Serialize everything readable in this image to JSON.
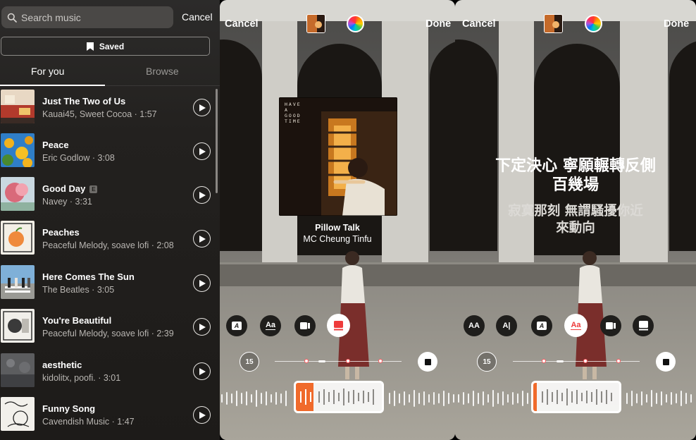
{
  "left_panel": {
    "search": {
      "placeholder": "Search music"
    },
    "cancel_label": "Cancel",
    "saved_label": "Saved",
    "tabs": [
      {
        "label": "For you",
        "active": true
      },
      {
        "label": "Browse",
        "active": false
      }
    ],
    "songs": [
      {
        "title": "Just The Two of Us",
        "meta": "Kauai45, Sweet Cocoa · 1:57",
        "explicit": false
      },
      {
        "title": "Peace",
        "meta": "Eric Godlow · 3:08",
        "explicit": false
      },
      {
        "title": "Good Day",
        "meta": "Navey · 3:31",
        "explicit": true,
        "badge": "E"
      },
      {
        "title": "Peaches",
        "meta": "Peaceful Melody, soave lofi · 2:08",
        "explicit": false
      },
      {
        "title": "Here Comes The Sun",
        "meta": "The Beatles · 3:05",
        "explicit": false
      },
      {
        "title": "You're Beautiful",
        "meta": "Peaceful Melody, soave lofi · 2:39",
        "explicit": false
      },
      {
        "title": "aesthetic",
        "meta": "kidolitx, poofi. · 3:01",
        "explicit": false
      },
      {
        "title": "Funny Song",
        "meta": "Cavendish Music · 1:47",
        "explicit": false
      }
    ]
  },
  "editor_album": {
    "cancel_label": "Cancel",
    "done_label": "Done",
    "song_title": "Pillow Talk",
    "song_artist": "MC Cheung Tinfu",
    "album_art_text": "HAVE A GOOD TIME",
    "duration_label": "15",
    "text_style_icon": "A",
    "font_icon": "Aa"
  },
  "editor_lyrics": {
    "cancel_label": "Cancel",
    "done_label": "Done",
    "lyric_line_1": "下定決心 寧願輾轉反側",
    "lyric_line_1b": "百幾場",
    "lyric_line_2": "寂寞那刻 無謂騷擾你近",
    "lyric_line_2b": "來動向",
    "duration_label": "15",
    "style_icons": [
      "AA",
      "A|",
      "A",
      "Aa"
    ]
  },
  "colors": {
    "accent": "#f06a2b",
    "marker": "#ff5a5f"
  }
}
